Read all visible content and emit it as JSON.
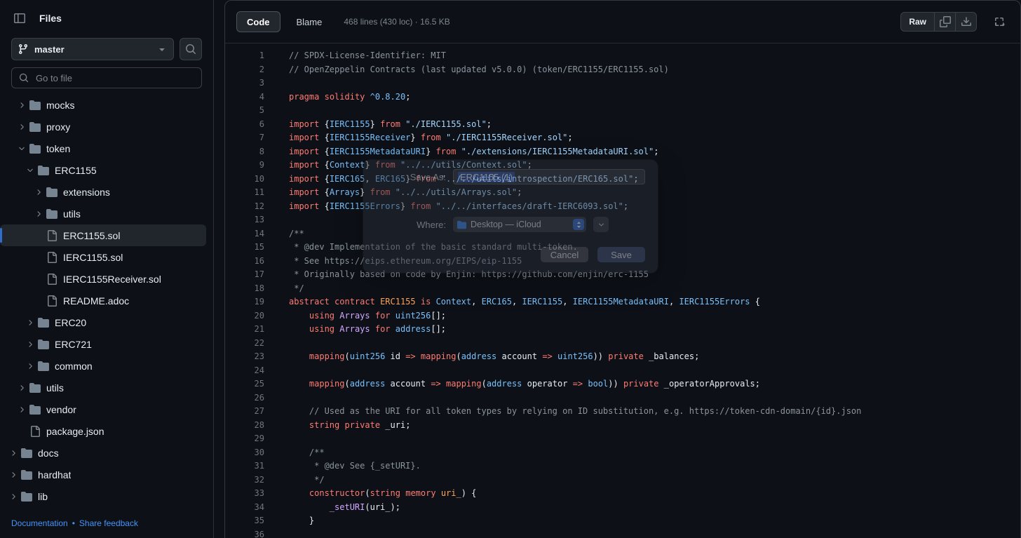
{
  "sidebar": {
    "title": "Files",
    "branch": {
      "name": "master"
    },
    "search_placeholder": "Go to file",
    "tree": [
      {
        "name": "mocks",
        "type": "folder",
        "depth": 1,
        "state": "collapsed"
      },
      {
        "name": "proxy",
        "type": "folder",
        "depth": 1,
        "state": "collapsed"
      },
      {
        "name": "token",
        "type": "folder",
        "depth": 1,
        "state": "expanded"
      },
      {
        "name": "ERC1155",
        "type": "folder",
        "depth": 2,
        "state": "expanded"
      },
      {
        "name": "extensions",
        "type": "folder",
        "depth": 3,
        "state": "collapsed"
      },
      {
        "name": "utils",
        "type": "folder",
        "depth": 3,
        "state": "collapsed"
      },
      {
        "name": "ERC1155.sol",
        "type": "file",
        "depth": 3,
        "selected": true
      },
      {
        "name": "IERC1155.sol",
        "type": "file",
        "depth": 3
      },
      {
        "name": "IERC1155Receiver.sol",
        "type": "file",
        "depth": 3
      },
      {
        "name": "README.adoc",
        "type": "file",
        "depth": 3
      },
      {
        "name": "ERC20",
        "type": "folder",
        "depth": 2,
        "state": "collapsed"
      },
      {
        "name": "ERC721",
        "type": "folder",
        "depth": 2,
        "state": "collapsed"
      },
      {
        "name": "common",
        "type": "folder",
        "depth": 2,
        "state": "collapsed"
      },
      {
        "name": "utils",
        "type": "folder",
        "depth": 1,
        "state": "collapsed"
      },
      {
        "name": "vendor",
        "type": "folder",
        "depth": 1,
        "state": "collapsed"
      },
      {
        "name": "package.json",
        "type": "file",
        "depth": 1
      },
      {
        "name": "docs",
        "type": "folder",
        "depth": 0,
        "state": "collapsed"
      },
      {
        "name": "hardhat",
        "type": "folder",
        "depth": 0,
        "state": "collapsed"
      },
      {
        "name": "lib",
        "type": "folder",
        "depth": 0,
        "state": "collapsed"
      }
    ],
    "footer": {
      "link1": "Documentation",
      "separator": "•",
      "link2": "Share feedback"
    }
  },
  "toolbar": {
    "tabs": [
      {
        "label": "Code",
        "active": true
      },
      {
        "label": "Blame",
        "active": false
      }
    ],
    "meta": "468 lines (430 loc) · 16.5 KB",
    "raw_label": "Raw"
  },
  "dialog": {
    "save_as_label": "Save As:",
    "filename": "ERC1155 (1)",
    "where_label": "Where:",
    "where_value": "Desktop — iCloud",
    "cancel_label": "Cancel",
    "save_label": "Save"
  },
  "colors": {
    "background": "#0d1117",
    "border": "#30363d",
    "accent_blue": "#316dca",
    "link_blue": "#4493f8",
    "keyword": "#ff7b72",
    "type": "#79c0fa",
    "string": "#a5d6ff",
    "function": "#d2a8ff",
    "entity": "#ffa657",
    "comment": "#8b949e"
  },
  "code": {
    "lines": [
      [
        [
          "// SPDX-License-Identifier: MIT",
          "c"
        ]
      ],
      [
        [
          "// OpenZeppelin Contracts (last updated v5.0.0) (token/ERC1155/ERC1155.sol)",
          "c"
        ]
      ],
      [],
      [
        [
          "pragma",
          "k"
        ],
        [
          " ",
          "p"
        ],
        [
          "solidity",
          "k"
        ],
        [
          " ",
          "p"
        ],
        [
          "^0.8.20",
          "t"
        ],
        [
          ";",
          "p"
        ]
      ],
      [],
      [
        [
          "import",
          "k"
        ],
        [
          " {",
          "p"
        ],
        [
          "IERC1155",
          "t"
        ],
        [
          "} ",
          "p"
        ],
        [
          "from",
          "k"
        ],
        [
          " ",
          "p"
        ],
        [
          "\"./IERC1155.sol\"",
          "s"
        ],
        [
          ";",
          "p"
        ]
      ],
      [
        [
          "import",
          "k"
        ],
        [
          " {",
          "p"
        ],
        [
          "IERC1155Receiver",
          "t"
        ],
        [
          "} ",
          "p"
        ],
        [
          "from",
          "k"
        ],
        [
          " ",
          "p"
        ],
        [
          "\"./IERC1155Receiver.sol\"",
          "s"
        ],
        [
          ";",
          "p"
        ]
      ],
      [
        [
          "import",
          "k"
        ],
        [
          " {",
          "p"
        ],
        [
          "IERC1155MetadataURI",
          "t"
        ],
        [
          "} ",
          "p"
        ],
        [
          "from",
          "k"
        ],
        [
          " ",
          "p"
        ],
        [
          "\"./extensions/IERC1155MetadataURI.sol\"",
          "s"
        ],
        [
          ";",
          "p"
        ]
      ],
      [
        [
          "import",
          "k"
        ],
        [
          " {",
          "p"
        ],
        [
          "Context",
          "t"
        ],
        [
          "} ",
          "p"
        ],
        [
          "from",
          "k"
        ],
        [
          " ",
          "p"
        ],
        [
          "\"../../utils/Context.sol\"",
          "s"
        ],
        [
          ";",
          "p"
        ]
      ],
      [
        [
          "import",
          "k"
        ],
        [
          " {",
          "p"
        ],
        [
          "IERC165",
          "t"
        ],
        [
          ", ",
          "p"
        ],
        [
          "ERC165",
          "t"
        ],
        [
          "} ",
          "p"
        ],
        [
          "from",
          "k"
        ],
        [
          " ",
          "p"
        ],
        [
          "\"../../utils/introspection/ERC165.sol\"",
          "s"
        ],
        [
          ";",
          "p"
        ]
      ],
      [
        [
          "import",
          "k"
        ],
        [
          " {",
          "p"
        ],
        [
          "Arrays",
          "t"
        ],
        [
          "} ",
          "p"
        ],
        [
          "from",
          "k"
        ],
        [
          " ",
          "p"
        ],
        [
          "\"../../utils/Arrays.sol\"",
          "s"
        ],
        [
          ";",
          "p"
        ]
      ],
      [
        [
          "import",
          "k"
        ],
        [
          " {",
          "p"
        ],
        [
          "IERC1155Errors",
          "t"
        ],
        [
          "} ",
          "p"
        ],
        [
          "from",
          "k"
        ],
        [
          " ",
          "p"
        ],
        [
          "\"../../interfaces/draft-IERC6093.sol\"",
          "s"
        ],
        [
          ";",
          "p"
        ]
      ],
      [],
      [
        [
          "/**",
          "c"
        ]
      ],
      [
        [
          " * @dev Implementation of the basic standard multi-token.",
          "c"
        ]
      ],
      [
        [
          " * See https://eips.ethereum.org/EIPS/eip-1155",
          "c"
        ]
      ],
      [
        [
          " * Originally based on code by Enjin: https://github.com/enjin/erc-1155",
          "c"
        ]
      ],
      [
        [
          " */",
          "c"
        ]
      ],
      [
        [
          "abstract",
          "k"
        ],
        [
          " ",
          "p"
        ],
        [
          "contract",
          "k"
        ],
        [
          " ",
          "p"
        ],
        [
          "ERC1155",
          "e"
        ],
        [
          " ",
          "p"
        ],
        [
          "is",
          "k"
        ],
        [
          " ",
          "p"
        ],
        [
          "Context",
          "t"
        ],
        [
          ", ",
          "p"
        ],
        [
          "ERC165",
          "t"
        ],
        [
          ", ",
          "p"
        ],
        [
          "IERC1155",
          "t"
        ],
        [
          ", ",
          "p"
        ],
        [
          "IERC1155MetadataURI",
          "t"
        ],
        [
          ", ",
          "p"
        ],
        [
          "IERC1155Errors",
          "t"
        ],
        [
          " {",
          "p"
        ]
      ],
      [
        [
          "    ",
          "p"
        ],
        [
          "using",
          "k"
        ],
        [
          " ",
          "p"
        ],
        [
          "Arrays",
          "f"
        ],
        [
          " ",
          "p"
        ],
        [
          "for",
          "k"
        ],
        [
          " ",
          "p"
        ],
        [
          "uint256",
          "t"
        ],
        [
          "[];",
          "p"
        ]
      ],
      [
        [
          "    ",
          "p"
        ],
        [
          "using",
          "k"
        ],
        [
          " ",
          "p"
        ],
        [
          "Arrays",
          "f"
        ],
        [
          " ",
          "p"
        ],
        [
          "for",
          "k"
        ],
        [
          " ",
          "p"
        ],
        [
          "address",
          "t"
        ],
        [
          "[];",
          "p"
        ]
      ],
      [],
      [
        [
          "    ",
          "p"
        ],
        [
          "mapping",
          "k"
        ],
        [
          "(",
          "p"
        ],
        [
          "uint256",
          "t"
        ],
        [
          " id ",
          "p"
        ],
        [
          "=>",
          "k"
        ],
        [
          " ",
          "p"
        ],
        [
          "mapping",
          "k"
        ],
        [
          "(",
          "p"
        ],
        [
          "address",
          "t"
        ],
        [
          " account ",
          "p"
        ],
        [
          "=>",
          "k"
        ],
        [
          " ",
          "p"
        ],
        [
          "uint256",
          "t"
        ],
        [
          ")) ",
          "p"
        ],
        [
          "private",
          "k"
        ],
        [
          " _balances;",
          "p"
        ]
      ],
      [],
      [
        [
          "    ",
          "p"
        ],
        [
          "mapping",
          "k"
        ],
        [
          "(",
          "p"
        ],
        [
          "address",
          "t"
        ],
        [
          " account ",
          "p"
        ],
        [
          "=>",
          "k"
        ],
        [
          " ",
          "p"
        ],
        [
          "mapping",
          "k"
        ],
        [
          "(",
          "p"
        ],
        [
          "address",
          "t"
        ],
        [
          " operator ",
          "p"
        ],
        [
          "=>",
          "k"
        ],
        [
          " ",
          "p"
        ],
        [
          "bool",
          "t"
        ],
        [
          ")) ",
          "p"
        ],
        [
          "private",
          "k"
        ],
        [
          " _operatorApprovals;",
          "p"
        ]
      ],
      [],
      [
        [
          "    // Used as the URI for all token types by relying on ID substitution, e.g. https://token-cdn-domain/{id}.json",
          "c"
        ]
      ],
      [
        [
          "    ",
          "p"
        ],
        [
          "string",
          "k"
        ],
        [
          " ",
          "p"
        ],
        [
          "private",
          "k"
        ],
        [
          " _uri;",
          "p"
        ]
      ],
      [],
      [
        [
          "    /**",
          "c"
        ]
      ],
      [
        [
          "     * @dev See {_setURI}.",
          "c"
        ]
      ],
      [
        [
          "     */",
          "c"
        ]
      ],
      [
        [
          "    ",
          "p"
        ],
        [
          "constructor",
          "k"
        ],
        [
          "(",
          "p"
        ],
        [
          "string",
          "k"
        ],
        [
          " ",
          "p"
        ],
        [
          "memory",
          "k"
        ],
        [
          " ",
          "p"
        ],
        [
          "uri_",
          "e"
        ],
        [
          ") {",
          "p"
        ]
      ],
      [
        [
          "        ",
          "p"
        ],
        [
          "_setURI",
          "f"
        ],
        [
          "(uri_);",
          "p"
        ]
      ],
      [
        [
          "    }",
          "p"
        ]
      ],
      []
    ]
  }
}
